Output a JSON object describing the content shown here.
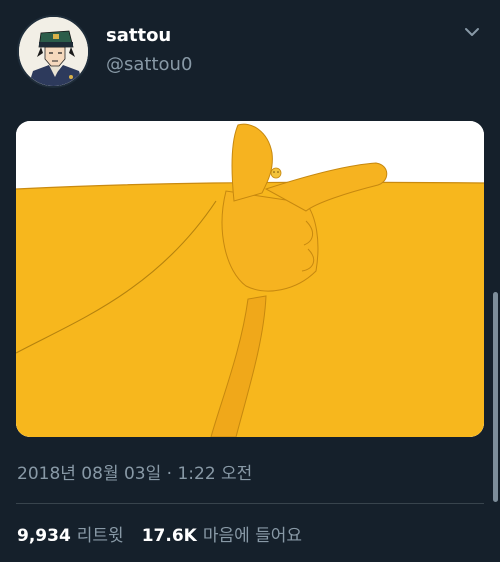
{
  "tweet": {
    "display_name": "sattou",
    "handle": "@sattou0",
    "timestamp": "2018년 08월 03일 · 1:22 오전",
    "retweets": {
      "count": "9,934",
      "label": "리트윗"
    },
    "likes": {
      "count": "17.6K",
      "label": "마음에 들어요"
    }
  },
  "icons": {
    "avatar": "anime-character-avatar",
    "menu": "chevron-down-icon"
  },
  "colors": {
    "background": "#15202b",
    "secondary_text": "#8899a6",
    "divider": "#38444d",
    "media_yellow": "#f7b71d"
  }
}
